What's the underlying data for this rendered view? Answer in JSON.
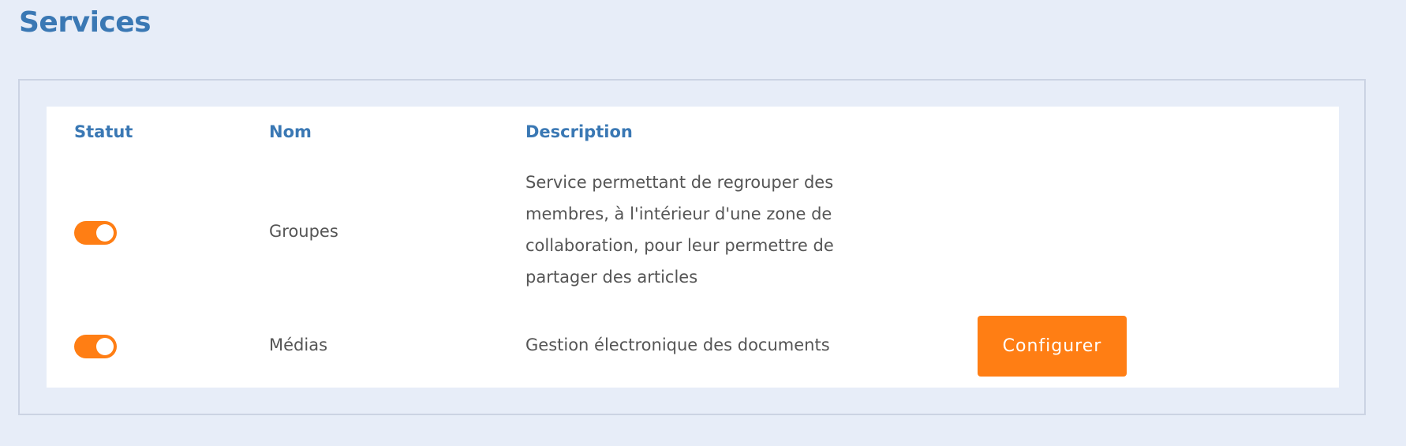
{
  "page": {
    "title": "Services"
  },
  "table": {
    "headers": {
      "status": "Statut",
      "name": "Nom",
      "description": "Description"
    },
    "rows": [
      {
        "enabled": true,
        "name": "Groupes",
        "description": "Service permettant de regrouper des membres, à l'intérieur d'une zone de collaboration, pour leur permettre de partager des articles",
        "action": ""
      },
      {
        "enabled": true,
        "name": "Médias",
        "description": "Gestion électronique des documents",
        "action": "Configurer"
      }
    ]
  },
  "colors": {
    "accent": "#ff7e14",
    "heading": "#3a78b4",
    "background": "#e7edf8",
    "text": "#555555"
  }
}
